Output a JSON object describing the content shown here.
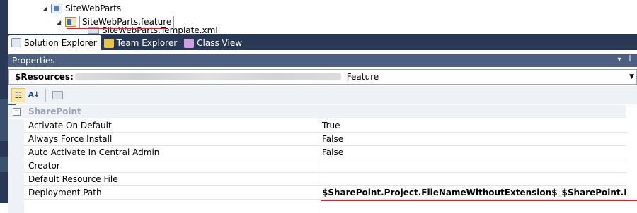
{
  "tree": {
    "items": [
      {
        "label": "SiteWebParts",
        "kind": "project"
      },
      {
        "label": "SiteWebParts.feature",
        "kind": "feature",
        "selected": true
      },
      {
        "label": "SiteWebParts.Template.xml",
        "kind": "file"
      }
    ]
  },
  "tabs": [
    {
      "label": "Solution Explorer",
      "active": true
    },
    {
      "label": "Team Explorer",
      "active": false
    },
    {
      "label": "Class View",
      "active": false
    }
  ],
  "properties": {
    "title": "Properties",
    "object_name": "$Resources:",
    "object_type": "Feature",
    "category": "SharePoint",
    "rows": [
      {
        "name": "Activate On Default",
        "value": "True"
      },
      {
        "name": "Always Force Install",
        "value": "False"
      },
      {
        "name": "Auto Activate In Central Admin",
        "value": "False"
      },
      {
        "name": "Creator",
        "value": ""
      },
      {
        "name": "Default Resource File",
        "value": ""
      },
      {
        "name": "Deployment Path",
        "value": "$SharePoint.Project.FileNameWithoutExtension$_$SharePoint.Feature.FileNam"
      }
    ]
  },
  "colors": {
    "accent_red": "#e0202a",
    "panel_dark": "#293955",
    "title_bar": "#4d6082"
  }
}
